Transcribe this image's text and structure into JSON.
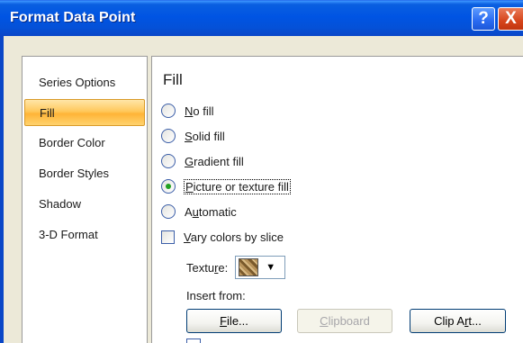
{
  "window": {
    "title": "Format Data Point",
    "help_button": "?",
    "close_button": "X"
  },
  "nav": {
    "items": [
      {
        "label": "Series Options",
        "selected": false
      },
      {
        "label": "Fill",
        "selected": true
      },
      {
        "label": "Border Color",
        "selected": false
      },
      {
        "label": "Border Styles",
        "selected": false
      },
      {
        "label": "Shadow",
        "selected": false
      },
      {
        "label": "3-D Format",
        "selected": false
      }
    ]
  },
  "fill": {
    "heading": "Fill",
    "options": {
      "no_fill": {
        "pre": "",
        "key": "N",
        "post": "o fill",
        "checked": false
      },
      "solid_fill": {
        "pre": "",
        "key": "S",
        "post": "olid fill",
        "checked": false
      },
      "gradient_fill": {
        "pre": "",
        "key": "G",
        "post": "radient fill",
        "checked": false
      },
      "picture_fill": {
        "pre": "",
        "key": "P",
        "post": "icture or texture fill",
        "checked": true
      },
      "automatic": {
        "pre": "A",
        "key": "u",
        "post": "tomatic",
        "checked": false
      }
    },
    "vary_colors": {
      "pre": "",
      "key": "V",
      "post": "ary colors by slice",
      "checked": false
    },
    "texture": {
      "pre": "Textu",
      "key": "r",
      "post": "e:",
      "icon": "texture-swatch-icon"
    },
    "insert_from": "Insert from:",
    "buttons": {
      "file": {
        "pre": "",
        "key": "F",
        "post": "ile...",
        "disabled": false
      },
      "clipboard": {
        "pre": "",
        "key": "C",
        "post": "lipboard",
        "disabled": true
      },
      "clip_art": {
        "pre": "Clip A",
        "key": "r",
        "post": "t...",
        "disabled": false
      }
    }
  }
}
